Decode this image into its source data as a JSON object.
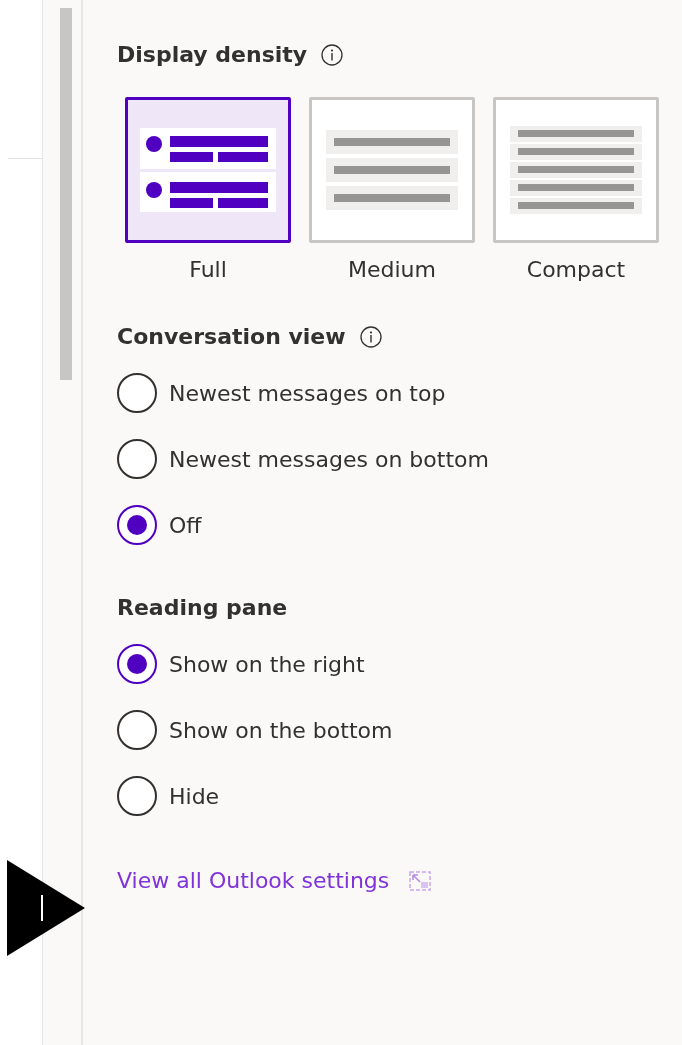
{
  "display_density": {
    "title": "Display density",
    "options": [
      {
        "label": "Full",
        "kind": "full",
        "selected": true
      },
      {
        "label": "Medium",
        "kind": "medium",
        "selected": false
      },
      {
        "label": "Compact",
        "kind": "compact",
        "selected": false
      }
    ]
  },
  "conversation_view": {
    "title": "Conversation view",
    "options": [
      {
        "label": "Newest messages on top",
        "selected": false
      },
      {
        "label": "Newest messages on bottom",
        "selected": false
      },
      {
        "label": "Off",
        "selected": true
      }
    ]
  },
  "reading_pane": {
    "title": "Reading pane",
    "options": [
      {
        "label": "Show on the right",
        "selected": true
      },
      {
        "label": "Show on the bottom",
        "selected": false
      },
      {
        "label": "Hide",
        "selected": false
      }
    ]
  },
  "settings_link": {
    "label": "View all Outlook settings"
  }
}
